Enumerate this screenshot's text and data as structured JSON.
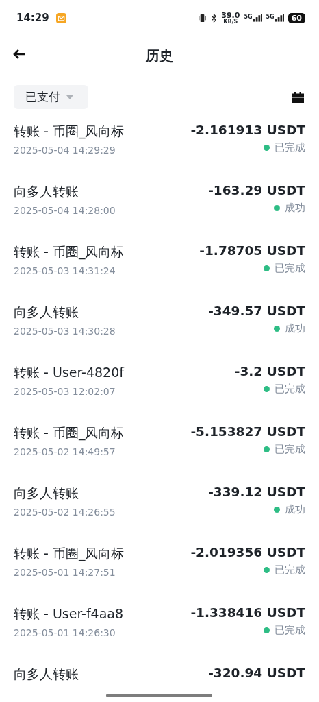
{
  "status_bar": {
    "time": "14:29",
    "network_speed": "39.0",
    "speed_unit": "KB/S",
    "sim_1": "5G",
    "sim_2": "5G",
    "battery": "60"
  },
  "header": {
    "title": "历史"
  },
  "filter": {
    "label": "已支付"
  },
  "transactions": [
    {
      "title": "转账 - 币圈_风向标",
      "date": "2025-05-04 14:29:29",
      "amount": "-2.161913 USDT",
      "status": "已完成"
    },
    {
      "title": "向多人转账",
      "date": "2025-05-04 14:28:00",
      "amount": "-163.29 USDT",
      "status": "成功"
    },
    {
      "title": "转账 - 币圈_风向标",
      "date": "2025-05-03 14:31:24",
      "amount": "-1.78705 USDT",
      "status": "已完成"
    },
    {
      "title": "向多人转账",
      "date": "2025-05-03 14:30:28",
      "amount": "-349.57 USDT",
      "status": "成功"
    },
    {
      "title": "转账 - User-4820f",
      "date": "2025-05-03 12:02:07",
      "amount": "-3.2 USDT",
      "status": "已完成"
    },
    {
      "title": "转账 - 币圈_风向标",
      "date": "2025-05-02 14:49:57",
      "amount": "-5.153827 USDT",
      "status": "已完成"
    },
    {
      "title": "向多人转账",
      "date": "2025-05-02 14:26:55",
      "amount": "-339.12 USDT",
      "status": "成功"
    },
    {
      "title": "转账 - 币圈_风向标",
      "date": "2025-05-01 14:27:51",
      "amount": "-2.019356 USDT",
      "status": "已完成"
    },
    {
      "title": "转账 - User-f4aa8",
      "date": "2025-05-01 14:26:30",
      "amount": "-1.338416 USDT",
      "status": "已完成"
    },
    {
      "title": "向多人转账",
      "amount": "-320.94 USDT"
    }
  ]
}
